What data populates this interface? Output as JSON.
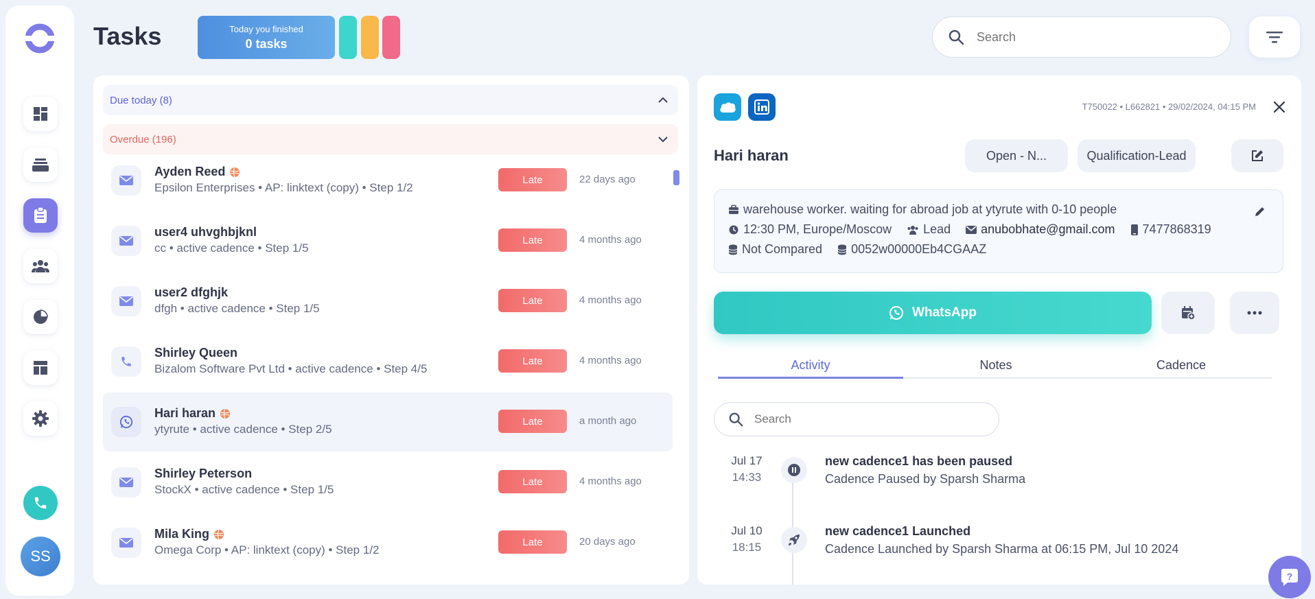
{
  "app": {
    "page_title": "Tasks",
    "finished": {
      "label": "Today you finished",
      "count": "0 tasks"
    },
    "accent_colors": {
      "teal": "#3dd6cc",
      "orange": "#f8b84a",
      "pink": "#f06a8a",
      "primary": "#7e7be6"
    }
  },
  "search": {
    "placeholder": "Search"
  },
  "sidebar": {
    "items": [
      {
        "icon": "dashboard-icon"
      },
      {
        "icon": "inbox-stack-icon"
      },
      {
        "icon": "clipboard-tasks-icon",
        "active": true
      },
      {
        "icon": "people-icon"
      },
      {
        "icon": "pie-chart-icon"
      },
      {
        "icon": "layout-template-icon"
      },
      {
        "icon": "gear-icon"
      }
    ],
    "avatar_initials": "SS"
  },
  "tasklist": {
    "due_today": "Due today (8)",
    "overdue": "Overdue (196)",
    "late_label": "Late",
    "tasks": [
      {
        "name": "Ayden Reed",
        "hot": true,
        "sub": "Epsilon Enterprises • AP: linktext (copy) • Step 1/2",
        "ago": "22 days ago",
        "type": "mail"
      },
      {
        "name": "user4 uhvghbjknl",
        "hot": false,
        "sub": "cc • active cadence • Step 1/5",
        "ago": "4 months ago",
        "type": "mail"
      },
      {
        "name": "user2 dfghjk",
        "hot": false,
        "sub": "dfgh • active cadence • Step 1/5",
        "ago": "4 months ago",
        "type": "mail"
      },
      {
        "name": "Shirley Queen",
        "hot": false,
        "sub": "Bizalom Software Pvt Ltd • active cadence • Step 4/5",
        "ago": "4 months ago",
        "type": "call"
      },
      {
        "name": "Hari haran",
        "hot": true,
        "sub": "ytyrute • active cadence • Step 2/5",
        "ago": "a month ago",
        "type": "whatsapp",
        "selected": true
      },
      {
        "name": "Shirley Peterson",
        "hot": false,
        "sub": "StockX • active cadence • Step 1/5",
        "ago": "4 months ago",
        "type": "mail"
      },
      {
        "name": "Mila King",
        "hot": true,
        "sub": "Omega Corp • AP: linktext (copy) • Step 1/2",
        "ago": "20 days ago",
        "type": "mail"
      }
    ]
  },
  "detail": {
    "meta": "T750022 • L662821 • 29/02/2024, 04:15 PM",
    "name": "Hari haran",
    "status": "Open - N...",
    "stage": "Qualification-Lead",
    "job": "warehouse worker. waiting for abroad job at ytyrute with 0-10 people",
    "time": "12:30 PM, Europe/Moscow",
    "type": "Lead",
    "email": "anubobhate@gmail.com",
    "phone": "7477868319",
    "compare": "Not Compared",
    "crm_id": "0052w00000Eb4CGAAZ",
    "whatsapp_label": "WhatsApp",
    "tabs": [
      "Activity",
      "Notes",
      "Cadence"
    ],
    "activity_search_placeholder": "Search",
    "events": [
      {
        "date": "Jul 17",
        "time": "14:33",
        "title": "new cadence1 has been paused",
        "desc": "Cadence Paused by Sparsh Sharma",
        "icon": "pause-icon"
      },
      {
        "date": "Jul 10",
        "time": "18:15",
        "title": "new cadence1 Launched",
        "desc": "Cadence Launched by Sparsh Sharma at 06:15 PM, Jul 10 2024",
        "icon": "rocket-icon"
      }
    ]
  }
}
